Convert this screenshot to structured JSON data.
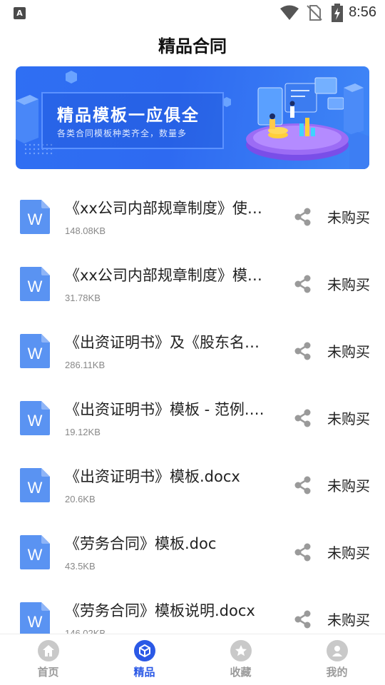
{
  "status_bar": {
    "app_icon_letter": "A",
    "time": "8:56"
  },
  "header": {
    "title": "精品合同"
  },
  "banner": {
    "title": "精品模板一应俱全",
    "subtitle": "各类合同模板种类齐全，数量多"
  },
  "documents": [
    {
      "name": "《xx公司内部规章制度》使用说明.docx",
      "size": "148.08KB",
      "status": "未购买"
    },
    {
      "name": "《xx公司内部规章制度》模板.docx",
      "size": "31.78KB",
      "status": "未购买"
    },
    {
      "name": "《出资证明书》及《股东名册》模板.docx",
      "size": "286.11KB",
      "status": "未购买"
    },
    {
      "name": "《出资证明书》模板 - 范例.docx",
      "size": "19.12KB",
      "status": "未购买"
    },
    {
      "name": "《出资证明书》模板.docx",
      "size": "20.6KB",
      "status": "未购买"
    },
    {
      "name": "《劳务合同》模板.doc",
      "size": "43.5KB",
      "status": "未购买"
    },
    {
      "name": "《劳务合同》模板说明.docx",
      "size": "146.02KB",
      "status": "未购买"
    }
  ],
  "icons": {
    "doc": "word-doc-icon",
    "share": "share-icon",
    "doc_letter": "W"
  },
  "bottom_nav": [
    {
      "label": "首页",
      "icon": "home-icon",
      "active": false
    },
    {
      "label": "精品",
      "icon": "cube-icon",
      "active": true
    },
    {
      "label": "收藏",
      "icon": "star-icon",
      "active": false
    },
    {
      "label": "我的",
      "icon": "user-icon",
      "active": false
    }
  ],
  "colors": {
    "accent": "#2b59e6",
    "banner": "#2f6ff3",
    "doc_icon": "#5a93f2",
    "inactive": "#9b9b9b"
  }
}
